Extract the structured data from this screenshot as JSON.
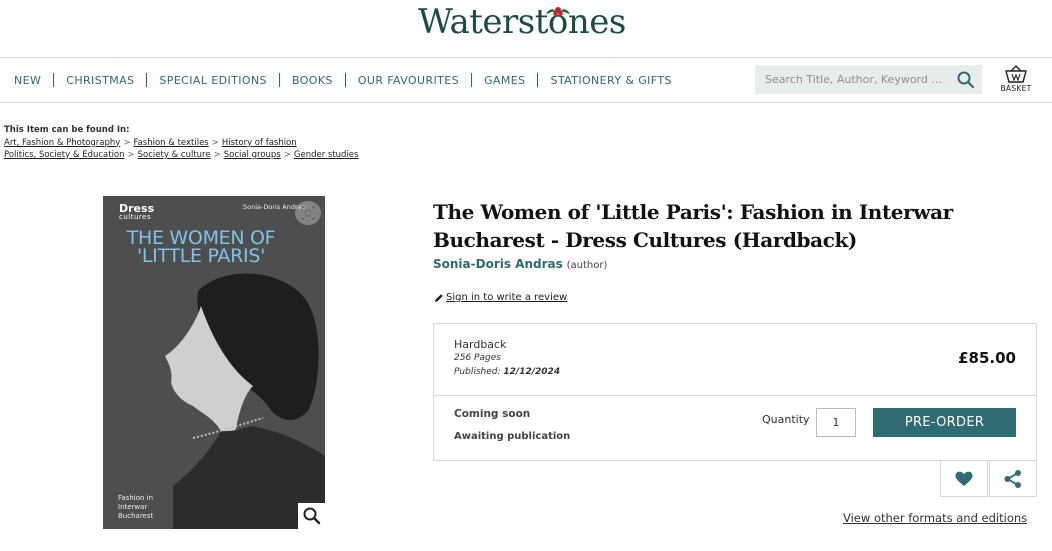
{
  "header": {
    "logo_text": "Waterstones",
    "brand_color": "#1d4e3b",
    "accent_color": "#2f6a73"
  },
  "nav": {
    "items": [
      "NEW",
      "CHRISTMAS",
      "SPECIAL EDITIONS",
      "BOOKS",
      "OUR FAVOURITES",
      "GAMES",
      "STATIONERY & GIFTS"
    ]
  },
  "search": {
    "placeholder": "Search Title, Author, Keyword ...",
    "icon": "search-icon"
  },
  "basket": {
    "label": "BASKET",
    "icon": "basket-icon"
  },
  "breadcrumbs": {
    "label": "This Item can be found In:",
    "trails": [
      [
        "Art, Fashion & Photography",
        "Fashion & textiles",
        "History of fashion"
      ],
      [
        "Politics, Society & Education",
        "Society & culture",
        "Social groups",
        "Gender studies"
      ]
    ]
  },
  "cover": {
    "series_name": "Dress",
    "series_sub": "cultures",
    "author": "Sonia-Doris Andras",
    "title": "THE WOMEN OF 'LITTLE PARIS'",
    "subtitle": "Fashion in\nInterwar\nBucharest",
    "title_color": "#7fc4e8"
  },
  "product": {
    "title": "The Women of 'Little Paris': Fashion in Interwar Bucharest - Dress Cultures (Hardback)",
    "author": "Sonia-Doris Andras",
    "author_role": "(author)",
    "review_link": "Sign in to write a review"
  },
  "buybox": {
    "format": "Hardback",
    "pages": "256 Pages",
    "published_label": "Published:",
    "published_date": "12/12/2024",
    "price": "£85.00",
    "availability": "Coming soon",
    "status": "Awaiting publication",
    "quantity_label": "Quantity",
    "quantity_value": "1",
    "button_label": "PRE-ORDER",
    "button_color": "#2e6b72"
  },
  "actions": {
    "wishlist_icon": "heart-icon",
    "share_icon": "share-icon",
    "other_formats": "View other formats and editions"
  }
}
